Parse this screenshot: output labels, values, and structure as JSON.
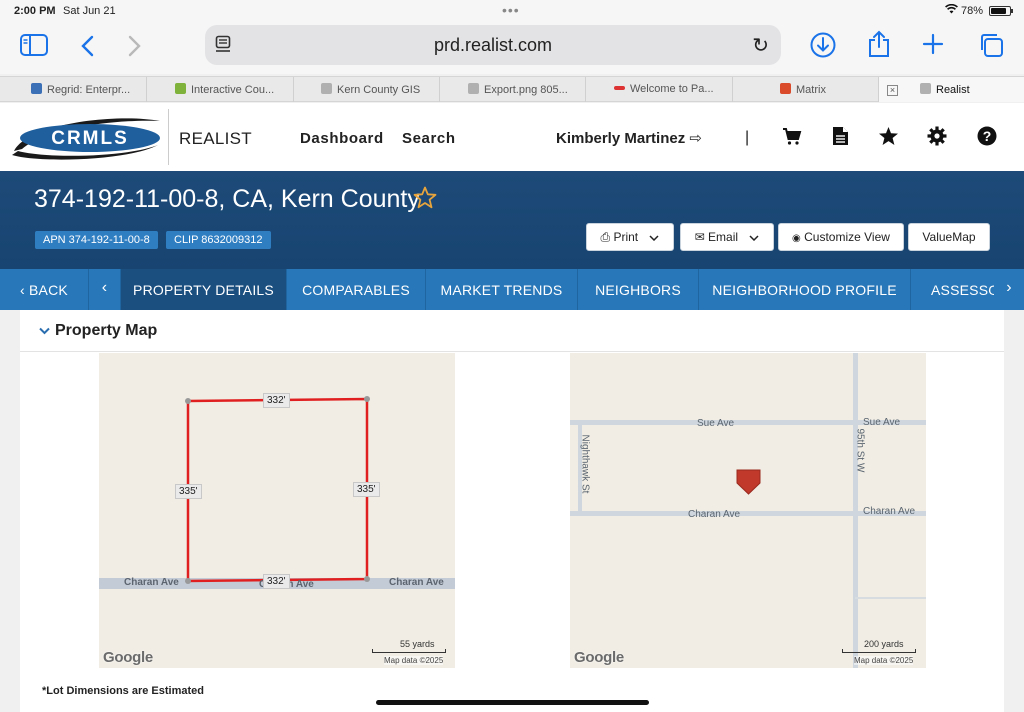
{
  "status_bar": {
    "time": "2:00 PM",
    "date": "Sat Jun 21",
    "battery": "78%"
  },
  "browser": {
    "url": "prd.realist.com",
    "tabs": [
      {
        "label": "Regrid: Enterpr...",
        "favicon_color": "#3b6fb6"
      },
      {
        "label": "Interactive Cou...",
        "favicon_color": "#7fb23a"
      },
      {
        "label": "Kern County GIS",
        "favicon_color": "#b0b0b0"
      },
      {
        "label": "Export.png 805...",
        "favicon_color": "#b0b0b0"
      },
      {
        "label": "Welcome to Pa...",
        "favicon_color": "#d33"
      },
      {
        "label": "Matrix",
        "favicon_color": "#d94b2b"
      },
      {
        "label": "Realist",
        "favicon_color": "#b0b0b0"
      }
    ]
  },
  "header": {
    "logo_text": "CRMLS",
    "brand": "REALIST",
    "nav": [
      "Dashboard",
      "Search"
    ],
    "user_name": "Kimberly Martinez"
  },
  "property": {
    "title": "374-192-11-00-8, CA, Kern County",
    "apn": "APN 374-192-11-00-8",
    "clip": "CLIP 8632009312",
    "buttons": {
      "print": "Print",
      "email": "Email",
      "customize": "Customize View",
      "valuemap": "ValueMap"
    }
  },
  "nav_tabs": {
    "back": "BACK",
    "tabs": [
      "PROPERTY DETAILS",
      "COMPARABLES",
      "MARKET TRENDS",
      "NEIGHBORS",
      "NEIGHBORHOOD PROFILE",
      "ASSESSOR"
    ],
    "active": "PROPERTY DETAILS"
  },
  "section": {
    "title": "Property Map",
    "note": "*Lot Dimensions are Estimated"
  },
  "map_left": {
    "dims": {
      "top": "332'",
      "bottom": "332'",
      "left": "335'",
      "right": "335'"
    },
    "street": "Charan Ave",
    "scale": "55 yards",
    "attribution": "Map data ©2025",
    "google": "Google"
  },
  "map_right": {
    "streets": {
      "sue_left": "Sue Ave",
      "sue_right": "Sue Ave",
      "charan_left": "Charan Ave",
      "charan_right": "Charan Ave",
      "nighthawk": "Nighthawk St",
      "st95": "95th St W"
    },
    "scale": "200 yards",
    "attribution": "Map data ©2025",
    "google": "Google"
  },
  "colors": {
    "banner": "#1d4a78",
    "nav": "#2877b8",
    "nav_active": "#1b4f80",
    "lot_outline": "#e02020",
    "marker": "#c0392b",
    "star": "#e7a43d"
  }
}
